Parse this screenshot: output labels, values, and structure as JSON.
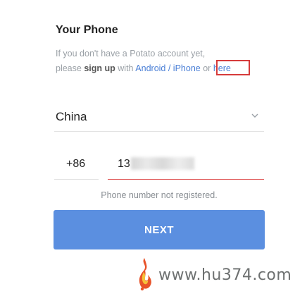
{
  "header": {
    "title": "Your Phone"
  },
  "description": {
    "line1": "If you don't have a Potato account yet,",
    "line2_prefix": "please",
    "sign_up": "sign up",
    "with": "with",
    "platforms_link": "Android / iPhone",
    "or": "or",
    "here_link": "here"
  },
  "country": {
    "selected": "China"
  },
  "phone": {
    "country_code": "+86",
    "number_visible_prefix": "13"
  },
  "status": {
    "error_message": "Phone number not registered."
  },
  "actions": {
    "next_label": "NEXT"
  },
  "watermark": {
    "text": "www.hu374.com"
  },
  "colors": {
    "accent": "#5b8fe0",
    "link": "#4a7fd6",
    "error_underline": "#e05a5a",
    "highlight_box": "#d63b3b"
  }
}
